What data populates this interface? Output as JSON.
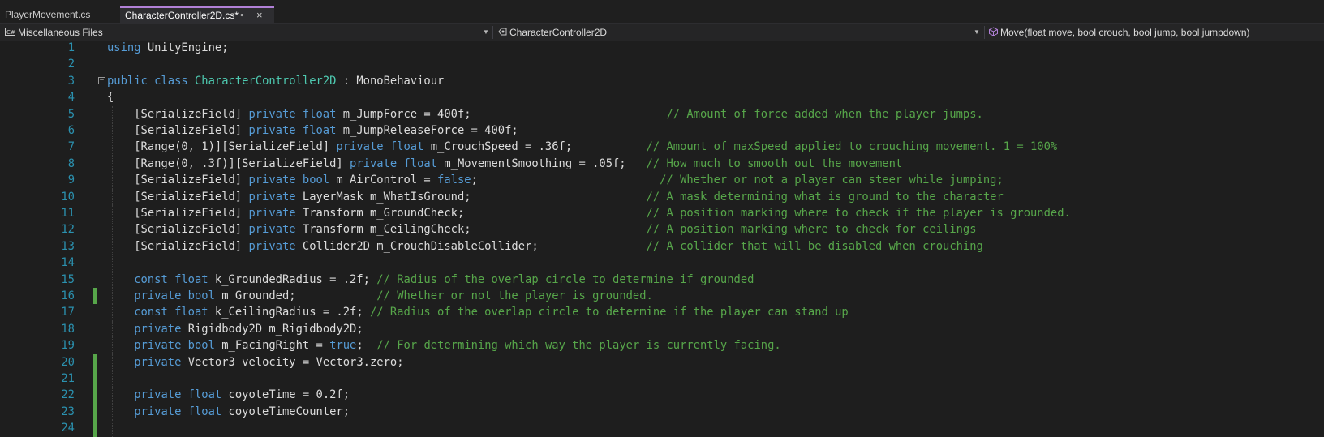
{
  "tabs": [
    {
      "label": "PlayerMovement.cs",
      "active": false
    },
    {
      "label": "CharacterController2D.cs*",
      "active": true
    }
  ],
  "tab_pin_icon": "pin-icon",
  "tab_close_icon": "close-icon",
  "navbar": {
    "project": "Miscellaneous Files",
    "type": "CharacterController2D",
    "member": "Move(float move, bool crouch, bool jump, bool jumpdown)"
  },
  "colors": {
    "keyword": "#569cd6",
    "type": "#4ec9b0",
    "comment": "#57a64a",
    "text": "#dcdcdc",
    "line_number": "#2b91af",
    "change_marker": "#57a64a",
    "active_tab_accent": "#b180d7"
  },
  "editor": {
    "lines": [
      {
        "num": "1",
        "changed": false,
        "fold": false,
        "guides": 0,
        "tokens": [
          [
            "kw",
            "using"
          ],
          [
            "tx",
            " UnityEngine;"
          ]
        ]
      },
      {
        "num": "2",
        "changed": false,
        "fold": false,
        "guides": 0,
        "tokens": []
      },
      {
        "num": "3",
        "changed": false,
        "fold": true,
        "guides": 0,
        "tokens": [
          [
            "kw",
            "public class"
          ],
          [
            "tx",
            " "
          ],
          [
            "ty",
            "CharacterController2D"
          ],
          [
            "tx",
            " : "
          ],
          [
            "tx",
            "MonoBehaviour"
          ]
        ]
      },
      {
        "num": "4",
        "changed": false,
        "fold": false,
        "guides": 0,
        "tokens": [
          [
            "tx",
            "{"
          ]
        ]
      },
      {
        "num": "5",
        "changed": false,
        "fold": false,
        "guides": 1,
        "tokens": [
          [
            "tx",
            "    [SerializeField] "
          ],
          [
            "kw",
            "private float"
          ],
          [
            "tx",
            " m_JumpForce = 400f;                             "
          ],
          [
            "cm",
            "// Amount of force added when the player jumps."
          ]
        ]
      },
      {
        "num": "6",
        "changed": false,
        "fold": false,
        "guides": 1,
        "tokens": [
          [
            "tx",
            "    [SerializeField] "
          ],
          [
            "kw",
            "private float"
          ],
          [
            "tx",
            " m_JumpReleaseForce = 400f;"
          ]
        ]
      },
      {
        "num": "7",
        "changed": false,
        "fold": false,
        "guides": 1,
        "tokens": [
          [
            "tx",
            "    [Range(0, 1)][SerializeField] "
          ],
          [
            "kw",
            "private float"
          ],
          [
            "tx",
            " m_CrouchSpeed = .36f;           "
          ],
          [
            "cm",
            "// Amount of maxSpeed applied to crouching movement. 1 = 100%"
          ]
        ]
      },
      {
        "num": "8",
        "changed": false,
        "fold": false,
        "guides": 1,
        "tokens": [
          [
            "tx",
            "    [Range(0, .3f)][SerializeField] "
          ],
          [
            "kw",
            "private float"
          ],
          [
            "tx",
            " m_MovementSmoothing = .05f;   "
          ],
          [
            "cm",
            "// How much to smooth out the movement"
          ]
        ]
      },
      {
        "num": "9",
        "changed": false,
        "fold": false,
        "guides": 1,
        "tokens": [
          [
            "tx",
            "    [SerializeField] "
          ],
          [
            "kw",
            "private bool"
          ],
          [
            "tx",
            " m_AirControl = "
          ],
          [
            "kw",
            "false"
          ],
          [
            "tx",
            ";                           "
          ],
          [
            "cm",
            "// Whether or not a player can steer while jumping;"
          ]
        ]
      },
      {
        "num": "10",
        "changed": false,
        "fold": false,
        "guides": 1,
        "tokens": [
          [
            "tx",
            "    [SerializeField] "
          ],
          [
            "kw",
            "private"
          ],
          [
            "tx",
            " LayerMask m_WhatIsGround;                          "
          ],
          [
            "cm",
            "// A mask determining what is ground to the character"
          ]
        ]
      },
      {
        "num": "11",
        "changed": false,
        "fold": false,
        "guides": 1,
        "tokens": [
          [
            "tx",
            "    [SerializeField] "
          ],
          [
            "kw",
            "private"
          ],
          [
            "tx",
            " Transform m_GroundCheck;                           "
          ],
          [
            "cm",
            "// A position marking where to check if the player is grounded."
          ]
        ]
      },
      {
        "num": "12",
        "changed": false,
        "fold": false,
        "guides": 1,
        "tokens": [
          [
            "tx",
            "    [SerializeField] "
          ],
          [
            "kw",
            "private"
          ],
          [
            "tx",
            " Transform m_CeilingCheck;                          "
          ],
          [
            "cm",
            "// A position marking where to check for ceilings"
          ]
        ]
      },
      {
        "num": "13",
        "changed": false,
        "fold": false,
        "guides": 1,
        "tokens": [
          [
            "tx",
            "    [SerializeField] "
          ],
          [
            "kw",
            "private"
          ],
          [
            "tx",
            " Collider2D m_CrouchDisableCollider;                "
          ],
          [
            "cm",
            "// A collider that will be disabled when crouching"
          ]
        ]
      },
      {
        "num": "14",
        "changed": false,
        "fold": false,
        "guides": 1,
        "tokens": []
      },
      {
        "num": "15",
        "changed": false,
        "fold": false,
        "guides": 1,
        "tokens": [
          [
            "tx",
            "    "
          ],
          [
            "kw",
            "const float"
          ],
          [
            "tx",
            " k_GroundedRadius = .2f; "
          ],
          [
            "cm",
            "// Radius of the overlap circle to determine if grounded"
          ]
        ]
      },
      {
        "num": "16",
        "changed": true,
        "fold": false,
        "guides": 1,
        "tokens": [
          [
            "tx",
            "    "
          ],
          [
            "kw",
            "private bool"
          ],
          [
            "tx",
            " m_Grounded;            "
          ],
          [
            "cm",
            "// Whether or not the player is grounded."
          ]
        ]
      },
      {
        "num": "17",
        "changed": false,
        "fold": false,
        "guides": 1,
        "tokens": [
          [
            "tx",
            "    "
          ],
          [
            "kw",
            "const float"
          ],
          [
            "tx",
            " k_CeilingRadius = .2f; "
          ],
          [
            "cm",
            "// Radius of the overlap circle to determine if the player can stand up"
          ]
        ]
      },
      {
        "num": "18",
        "changed": false,
        "fold": false,
        "guides": 1,
        "tokens": [
          [
            "tx",
            "    "
          ],
          [
            "kw",
            "private"
          ],
          [
            "tx",
            " Rigidbody2D m_Rigidbody2D;"
          ]
        ]
      },
      {
        "num": "19",
        "changed": false,
        "fold": false,
        "guides": 1,
        "tokens": [
          [
            "tx",
            "    "
          ],
          [
            "kw",
            "private bool"
          ],
          [
            "tx",
            " m_FacingRight = "
          ],
          [
            "kw",
            "true"
          ],
          [
            "tx",
            ";  "
          ],
          [
            "cm",
            "// For determining which way the player is currently facing."
          ]
        ]
      },
      {
        "num": "20",
        "changed": true,
        "fold": false,
        "guides": 1,
        "tokens": [
          [
            "tx",
            "    "
          ],
          [
            "kw",
            "private"
          ],
          [
            "tx",
            " Vector3 velocity = Vector3.zero;"
          ]
        ]
      },
      {
        "num": "21",
        "changed": true,
        "fold": false,
        "guides": 1,
        "tokens": []
      },
      {
        "num": "22",
        "changed": true,
        "fold": false,
        "guides": 1,
        "tokens": [
          [
            "tx",
            "    "
          ],
          [
            "kw",
            "private float"
          ],
          [
            "tx",
            " coyoteTime = 0.2f;"
          ]
        ]
      },
      {
        "num": "23",
        "changed": true,
        "fold": false,
        "guides": 1,
        "tokens": [
          [
            "tx",
            "    "
          ],
          [
            "kw",
            "private float"
          ],
          [
            "tx",
            " coyoteTimeCounter;"
          ]
        ]
      },
      {
        "num": "24",
        "changed": true,
        "fold": false,
        "guides": 1,
        "tokens": []
      }
    ]
  }
}
